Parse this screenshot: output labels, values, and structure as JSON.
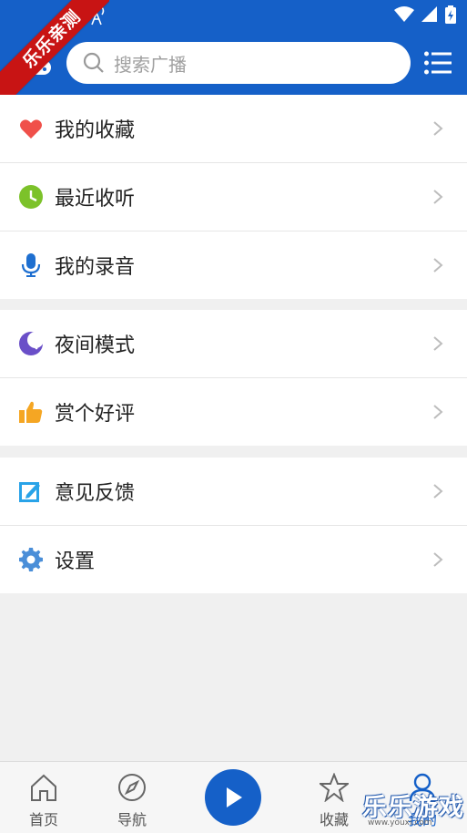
{
  "header": {
    "search_placeholder": "搜索广播",
    "ribbon_text": "乐乐亲测",
    "accent_color": "#1560c8"
  },
  "groups": [
    {
      "items": [
        {
          "label": "我的收藏",
          "icon": "heart-icon",
          "color": "#f0504a"
        },
        {
          "label": "最近收听",
          "icon": "clock-icon",
          "color": "#7cc22a"
        },
        {
          "label": "我的录音",
          "icon": "microphone-icon",
          "color": "#1e6fd0"
        }
      ]
    },
    {
      "items": [
        {
          "label": "夜间模式",
          "icon": "moon-icon",
          "color": "#6a4fc8"
        },
        {
          "label": "赏个好评",
          "icon": "thumbs-up-icon",
          "color": "#f5a623"
        }
      ]
    },
    {
      "items": [
        {
          "label": "意见反馈",
          "icon": "edit-icon",
          "color": "#29a3e8"
        },
        {
          "label": "设置",
          "icon": "gear-icon",
          "color": "#4a8ed8"
        }
      ]
    }
  ],
  "bottom_nav": {
    "home": "首页",
    "navigate": "导航",
    "favorites": "收藏",
    "mine": "我的"
  },
  "watermark": {
    "text": "乐乐游戏",
    "url": "www.youxi.com"
  }
}
